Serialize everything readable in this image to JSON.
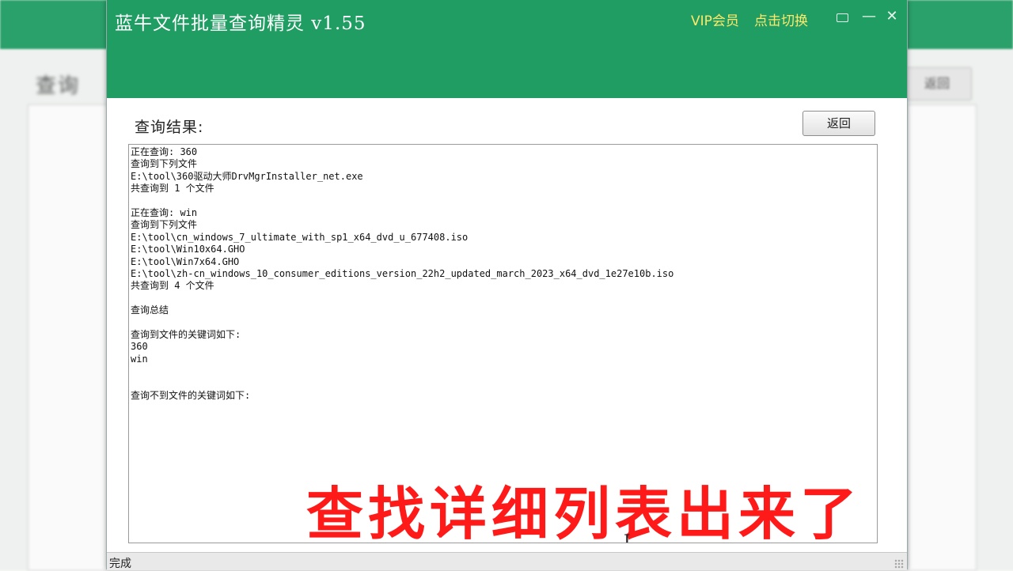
{
  "app": {
    "title": "蓝牛文件批量查询精灵  v1.55",
    "vip_label": "VIP会员",
    "switch_link": "点击切换"
  },
  "content": {
    "result_label": "查询结果:",
    "back_button": "返回",
    "result_lines": [
      "正在查询: 360",
      "查询到下列文件",
      "E:\\tool\\360驱动大师DrvMgrInstaller_net.exe",
      "共查询到 1 个文件",
      "",
      "正在查询: win",
      "查询到下列文件",
      "E:\\tool\\cn_windows_7_ultimate_with_sp1_x64_dvd_u_677408.iso",
      "E:\\tool\\Win10x64.GHO",
      "E:\\tool\\Win7x64.GHO",
      "E:\\tool\\zh-cn_windows_10_consumer_editions_version_22h2_updated_march_2023_x64_dvd_1e27e10b.iso",
      "共查询到 4 个文件",
      "",
      "查询总结",
      "",
      "查询到文件的关键词如下:",
      "360",
      "win",
      "",
      "",
      "查询不到文件的关键词如下:"
    ]
  },
  "overlay": {
    "caption": "查找详细列表出来了",
    "caption_color": "#ff1a1a"
  },
  "status": {
    "text": "完成"
  },
  "background": {
    "title": "查询",
    "button": "返回"
  },
  "icons": {
    "message": "message-icon",
    "minimize": "minimize-icon",
    "close": "close-icon",
    "cursor": "text-cursor-icon"
  },
  "colors": {
    "titlebar": "#1f9d62",
    "vip_text": "#ffe86a"
  }
}
